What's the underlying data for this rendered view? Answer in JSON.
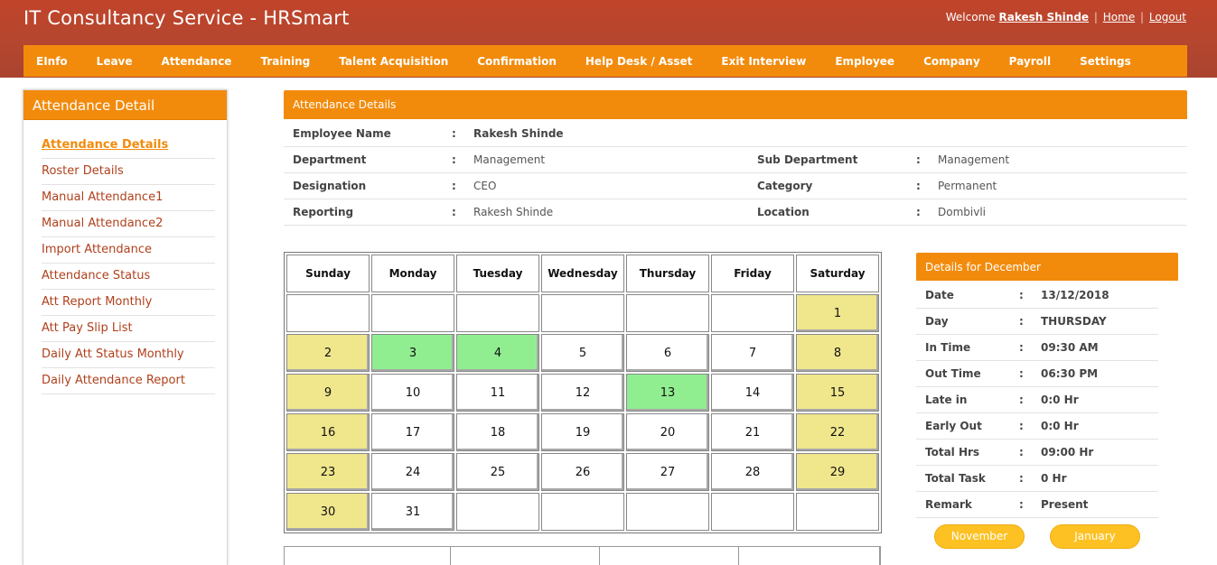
{
  "app_title": "IT Consultancy Service - HRSmart",
  "user": {
    "welcome": "Welcome",
    "name": "Rakesh Shinde",
    "home": "Home",
    "logout": "Logout"
  },
  "nav": [
    "EInfo",
    "Leave",
    "Attendance",
    "Training",
    "Talent Acquisition",
    "Confirmation",
    "Help Desk / Asset",
    "Exit Interview",
    "Employee",
    "Company",
    "Payroll",
    "Settings"
  ],
  "sidebar": {
    "title": "Attendance Detail",
    "items": [
      "Attendance Details",
      "Roster Details",
      "Manual Attendance1",
      "Manual Attendance2",
      "Import Attendance",
      "Attendance Status",
      "Att Report Monthly",
      "Att Pay Slip List",
      "Daily Att Status Monthly",
      "Daily Attendance Report"
    ]
  },
  "panel": {
    "title": "Attendance  Details",
    "employee_name_label": "Employee Name",
    "employee_name": "Rakesh Shinde",
    "department_label": "Department",
    "department": "Management",
    "sub_department_label": "Sub Department",
    "sub_department": "Management",
    "designation_label": "Designation",
    "designation": "CEO",
    "category_label": "Category",
    "category": "Permanent",
    "reporting_label": "Reporting",
    "reporting": "Rakesh Shinde",
    "location_label": "Location",
    "location": "Dombivli",
    "colon": ":"
  },
  "calendar": {
    "weekdays": [
      "Sunday",
      "Monday",
      "Tuesday",
      "Wednesday",
      "Thursday",
      "Friday",
      "Saturday"
    ],
    "weeks": [
      [
        {
          "d": ""
        },
        {
          "d": ""
        },
        {
          "d": ""
        },
        {
          "d": ""
        },
        {
          "d": ""
        },
        {
          "d": ""
        },
        {
          "d": "1",
          "s": "weekend"
        }
      ],
      [
        {
          "d": "2",
          "s": "weekend"
        },
        {
          "d": "3",
          "s": "present"
        },
        {
          "d": "4",
          "s": "present"
        },
        {
          "d": "5"
        },
        {
          "d": "6"
        },
        {
          "d": "7"
        },
        {
          "d": "8",
          "s": "weekend"
        }
      ],
      [
        {
          "d": "9",
          "s": "weekend"
        },
        {
          "d": "10"
        },
        {
          "d": "11"
        },
        {
          "d": "12"
        },
        {
          "d": "13",
          "s": "present"
        },
        {
          "d": "14"
        },
        {
          "d": "15",
          "s": "weekend"
        }
      ],
      [
        {
          "d": "16",
          "s": "weekend"
        },
        {
          "d": "17"
        },
        {
          "d": "18"
        },
        {
          "d": "19"
        },
        {
          "d": "20"
        },
        {
          "d": "21"
        },
        {
          "d": "22",
          "s": "weekend"
        }
      ],
      [
        {
          "d": "23",
          "s": "weekend"
        },
        {
          "d": "24"
        },
        {
          "d": "25"
        },
        {
          "d": "26"
        },
        {
          "d": "27"
        },
        {
          "d": "28"
        },
        {
          "d": "29",
          "s": "weekend"
        }
      ],
      [
        {
          "d": "30",
          "s": "weekend"
        },
        {
          "d": "31"
        },
        {
          "d": ""
        },
        {
          "d": ""
        },
        {
          "d": ""
        },
        {
          "d": ""
        },
        {
          "d": ""
        }
      ]
    ],
    "colors": {
      "weekend": "#f0e68c",
      "present": "#90ee90"
    }
  },
  "details": {
    "title": "Details for December",
    "rows": [
      {
        "label": "Date",
        "value": "13/12/2018"
      },
      {
        "label": "Day",
        "value": "THURSDAY"
      },
      {
        "label": "In Time",
        "value": "09:30 AM"
      },
      {
        "label": "Out Time",
        "value": "06:30 PM"
      },
      {
        "label": "Late in",
        "value": "0:0 Hr"
      },
      {
        "label": "Early Out",
        "value": "0:0 Hr"
      },
      {
        "label": "Total Hrs",
        "value": "09:00 Hr"
      },
      {
        "label": "Total Task",
        "value": "0 Hr"
      },
      {
        "label": "Remark",
        "value": "Present"
      }
    ],
    "colon": ":",
    "prev_month": "November",
    "next_month": "January"
  }
}
